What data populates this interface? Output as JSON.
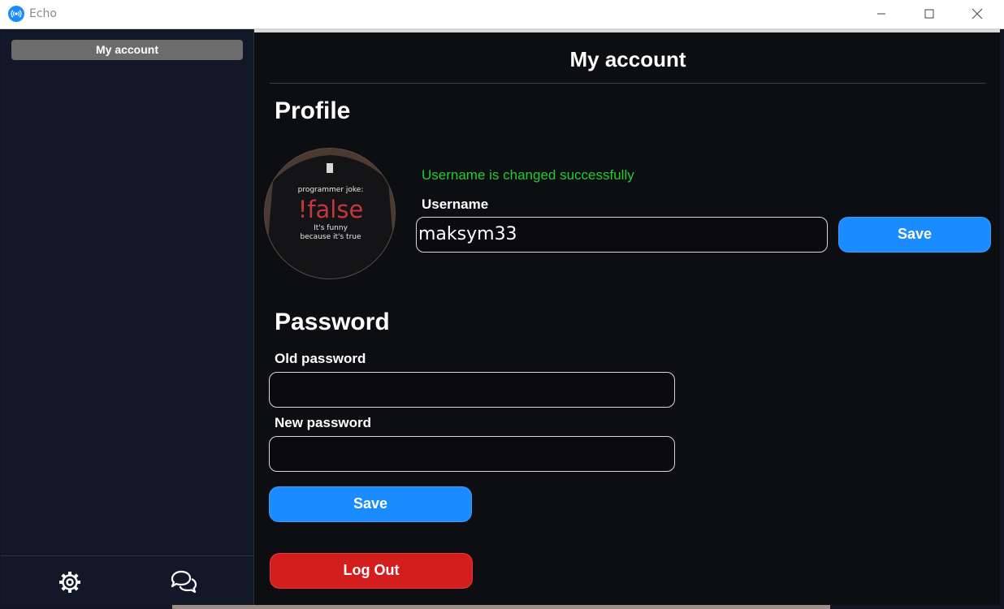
{
  "window": {
    "title": "Echo"
  },
  "sidebar": {
    "items": [
      {
        "label": "My account",
        "active": true
      }
    ],
    "footer": {
      "icons": [
        "gear-icon",
        "chat-bubbles-icon"
      ]
    }
  },
  "main": {
    "title": "My account",
    "profile": {
      "heading": "Profile",
      "avatar": {
        "caption_top": "programmer joke:",
        "caption_main": "!false",
        "caption_sub1": "It's funny",
        "caption_sub2": "because it's true"
      },
      "success_message": "Username is changed successfully",
      "username_label": "Username",
      "username_value": "maksym33",
      "save_label": "Save"
    },
    "password": {
      "heading": "Password",
      "old_label": "Old password",
      "old_value": "",
      "new_label": "New password",
      "new_value": "",
      "save_label": "Save"
    },
    "logout_label": "Log Out"
  },
  "colors": {
    "accent": "#1a8cff",
    "danger": "#d41e1e",
    "success": "#22cc33",
    "sidebar_bg": "#131828",
    "main_bg": "#0d0e12"
  }
}
